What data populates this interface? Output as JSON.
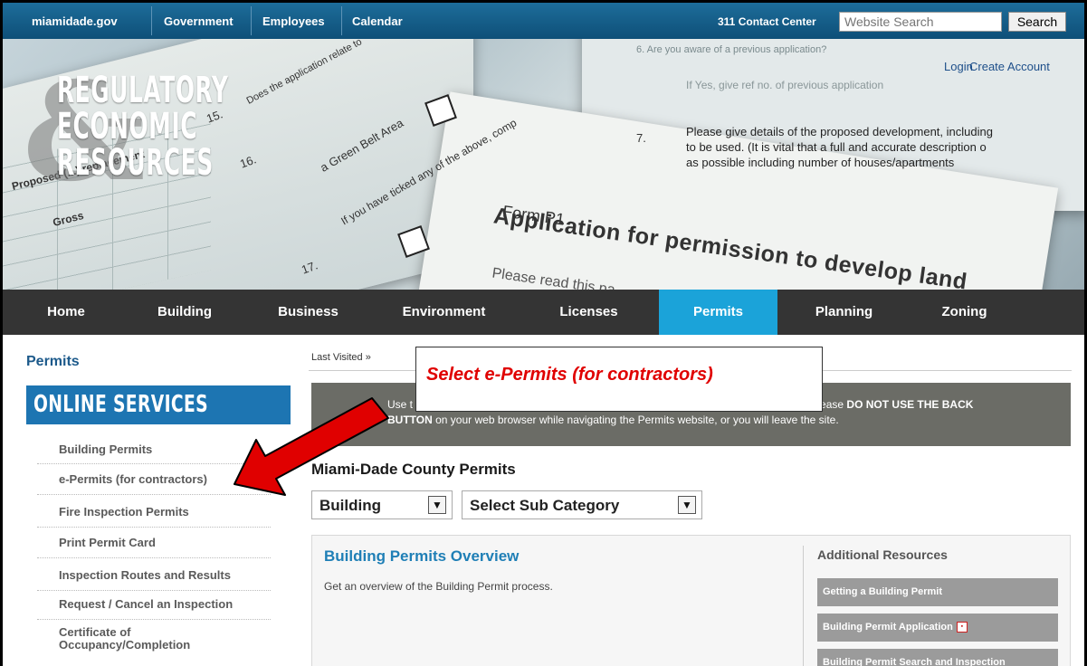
{
  "topbar": {
    "links": [
      "miamidade.gov",
      "Government",
      "Employees",
      "Calendar"
    ],
    "contact": "311 Contact Center",
    "search_placeholder": "Website Search",
    "search_button": "Search"
  },
  "account": {
    "login": "Login",
    "create": "Create Account"
  },
  "logo": {
    "lines": [
      "REGULATORY",
      "ECONOMIC",
      "RESOURCES"
    ]
  },
  "banner_text": {
    "form_p1": "Form P1",
    "application": "Application for permission to develop land",
    "please_read": "Please read this pa",
    "q6": "6.   Are you aware of a previous application?",
    "if_yes": "If Yes, give ref no. of previous application",
    "q7": "7.",
    "details": [
      "Please give details of the proposed development, including",
      "to be used.  (It is vital that a full and accurate description o",
      "as possible including number of houses/apartments"
    ],
    "q15": "15.",
    "q16": "16.",
    "q17": "17.",
    "does_the_application": "Does the application relate to",
    "green_belt": "a Green Belt Area",
    "ticked_any": "If you have ticked any of the above, comp",
    "proposed": "Proposed (...)  replacement",
    "gross": "Gross"
  },
  "mainnav": {
    "items": [
      "Home",
      "Building",
      "Business",
      "Environment",
      "Licenses",
      "Permits",
      "Planning",
      "Zoning"
    ],
    "active": "Permits"
  },
  "sidebar": {
    "title": "Permits",
    "online_services": "ONLINE SERVICES",
    "items": [
      "Building Permits",
      "e-Permits (for contractors)",
      "Fire Inspection Permits",
      "Print Permit Card",
      "Inspection Routes and Results",
      "Request / Cancel an Inspection",
      "Certificate of Occupancy/Completion"
    ]
  },
  "main": {
    "last_visited": "Last Visited »",
    "notice_line1_start": "Use t",
    "notice_line1_end": "nits. Please",
    "notice_bold1": "DO NOT USE THE BACK",
    "notice_bold2": "BUTTON",
    "notice_line2": "on your web browser while navigating the Permits website, or you will leave the site.",
    "county_title": "Miami-Dade County Permits",
    "category_select": "Building",
    "subcategory_select": "Select Sub Category",
    "overview_title": "Building Permits Overview",
    "overview_text": "Get an overview of the Building Permit process.",
    "resources_title": "Additional Resources",
    "resources": [
      "Getting a Building Permit",
      "Building Permit Application",
      "Building Permit Search and Inspection"
    ]
  },
  "annotation": {
    "text": "Select e-Permits (for contractors)",
    "color": "#e00000"
  },
  "colors": {
    "topbar": "#0e4f78",
    "nav_active": "#1ba3d9",
    "online_services": "#1d75b2",
    "notice": "#6b6c66"
  }
}
